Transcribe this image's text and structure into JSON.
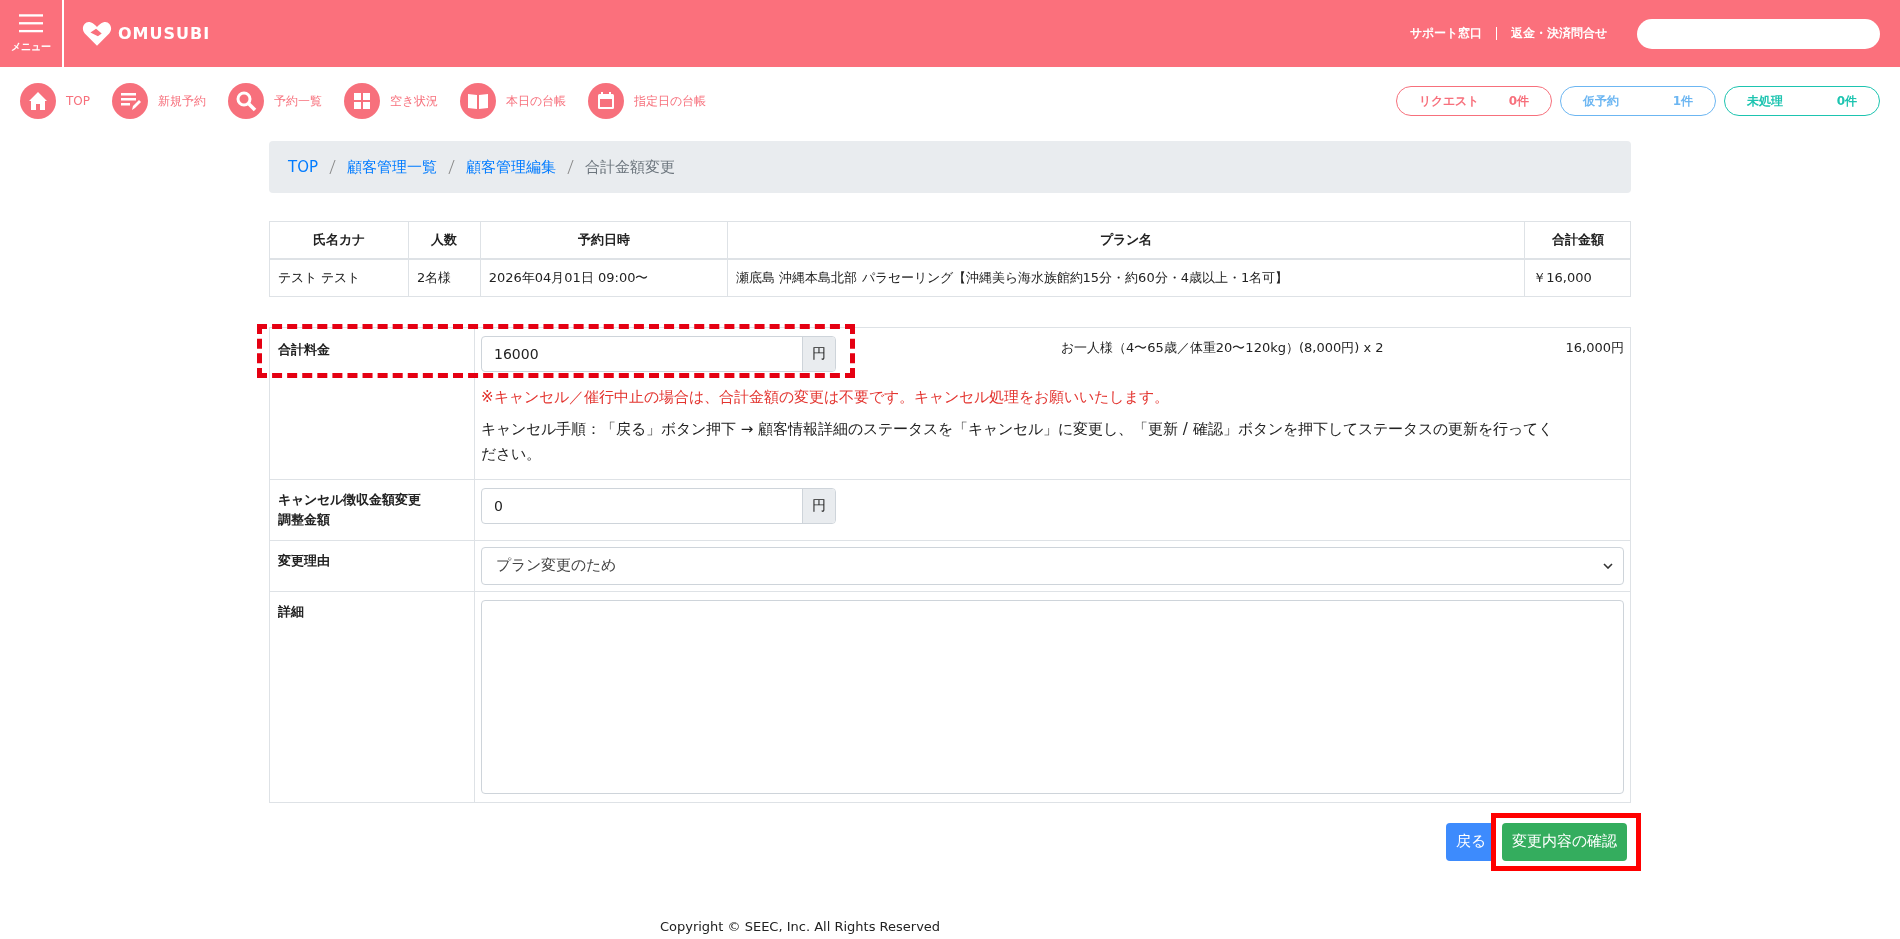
{
  "header": {
    "menu_label": "メニュー",
    "logo": "OMUSUBI",
    "links": [
      "サポート窓口",
      "返金・決済問合せ"
    ]
  },
  "nav": [
    {
      "label": "TOP",
      "kind": "home"
    },
    {
      "label": "新規予約",
      "kind": "edit"
    },
    {
      "label": "予約一覧",
      "kind": "search"
    },
    {
      "label": "空き状況",
      "kind": "grid"
    },
    {
      "label": "本日の台帳",
      "kind": "book"
    },
    {
      "label": "指定日の台帳",
      "kind": "calendar"
    }
  ],
  "counters": [
    {
      "label": "リクエスト",
      "count": "0件",
      "color": "#f7707c"
    },
    {
      "label": "仮予約",
      "count": "1件",
      "color": "#6cb6f2"
    },
    {
      "label": "未処理",
      "count": "0件",
      "color": "#1dc4b0"
    }
  ],
  "breadcrumb": [
    {
      "label": "TOP",
      "link": true
    },
    {
      "label": "顧客管理一覧",
      "link": true
    },
    {
      "label": "顧客管理編集",
      "link": true
    },
    {
      "label": "合計金額変更",
      "link": false
    }
  ],
  "summary_table": {
    "columns": [
      "氏名カナ",
      "人数",
      "予約日時",
      "プラン名",
      "合計金額"
    ],
    "rows": [
      [
        "テスト テスト",
        "2名様",
        "2026年04月01日 09:00〜",
        "瀬底島 沖縄本島北部 パラセーリング【沖縄美ら海水族館約15分・約60分・4歳以上・1名可】",
        "￥16,000"
      ]
    ]
  },
  "form": {
    "total": {
      "label": "合計料金",
      "value": "16000",
      "unit": "円",
      "highlighted": true,
      "breakdown": "お一人様（4〜65歳／体重20〜120kg）(8,000円) x 2",
      "breakdown_amount": "16,000円",
      "notice": "※キャンセル／催行中止の場合は、合計金額の変更は不要です。キャンセル処理をお願いいたします。",
      "instructions": "キャンセル手順：「戻る」ボタン押下 → 顧客情報詳細のステータスを「キャンセル」に変更し、「更新 / 確認」ボタンを押下してステータスの更新を行ってください。"
    },
    "cancel_fee": {
      "label_lines": [
        "キャンセル徴収金額変更",
        "調整金額"
      ],
      "value": "0",
      "unit": "円"
    },
    "reason": {
      "label": "変更理由",
      "value": "プラン変更のため"
    },
    "details": {
      "label": "詳細"
    }
  },
  "buttons": [
    {
      "label": "戻る",
      "kind": "back",
      "highlighted": false
    },
    {
      "label": "変更内容の確認",
      "kind": "confirm",
      "highlighted": true
    }
  ],
  "footer": "Copyright © SEEC, Inc. All Rights Reserved"
}
